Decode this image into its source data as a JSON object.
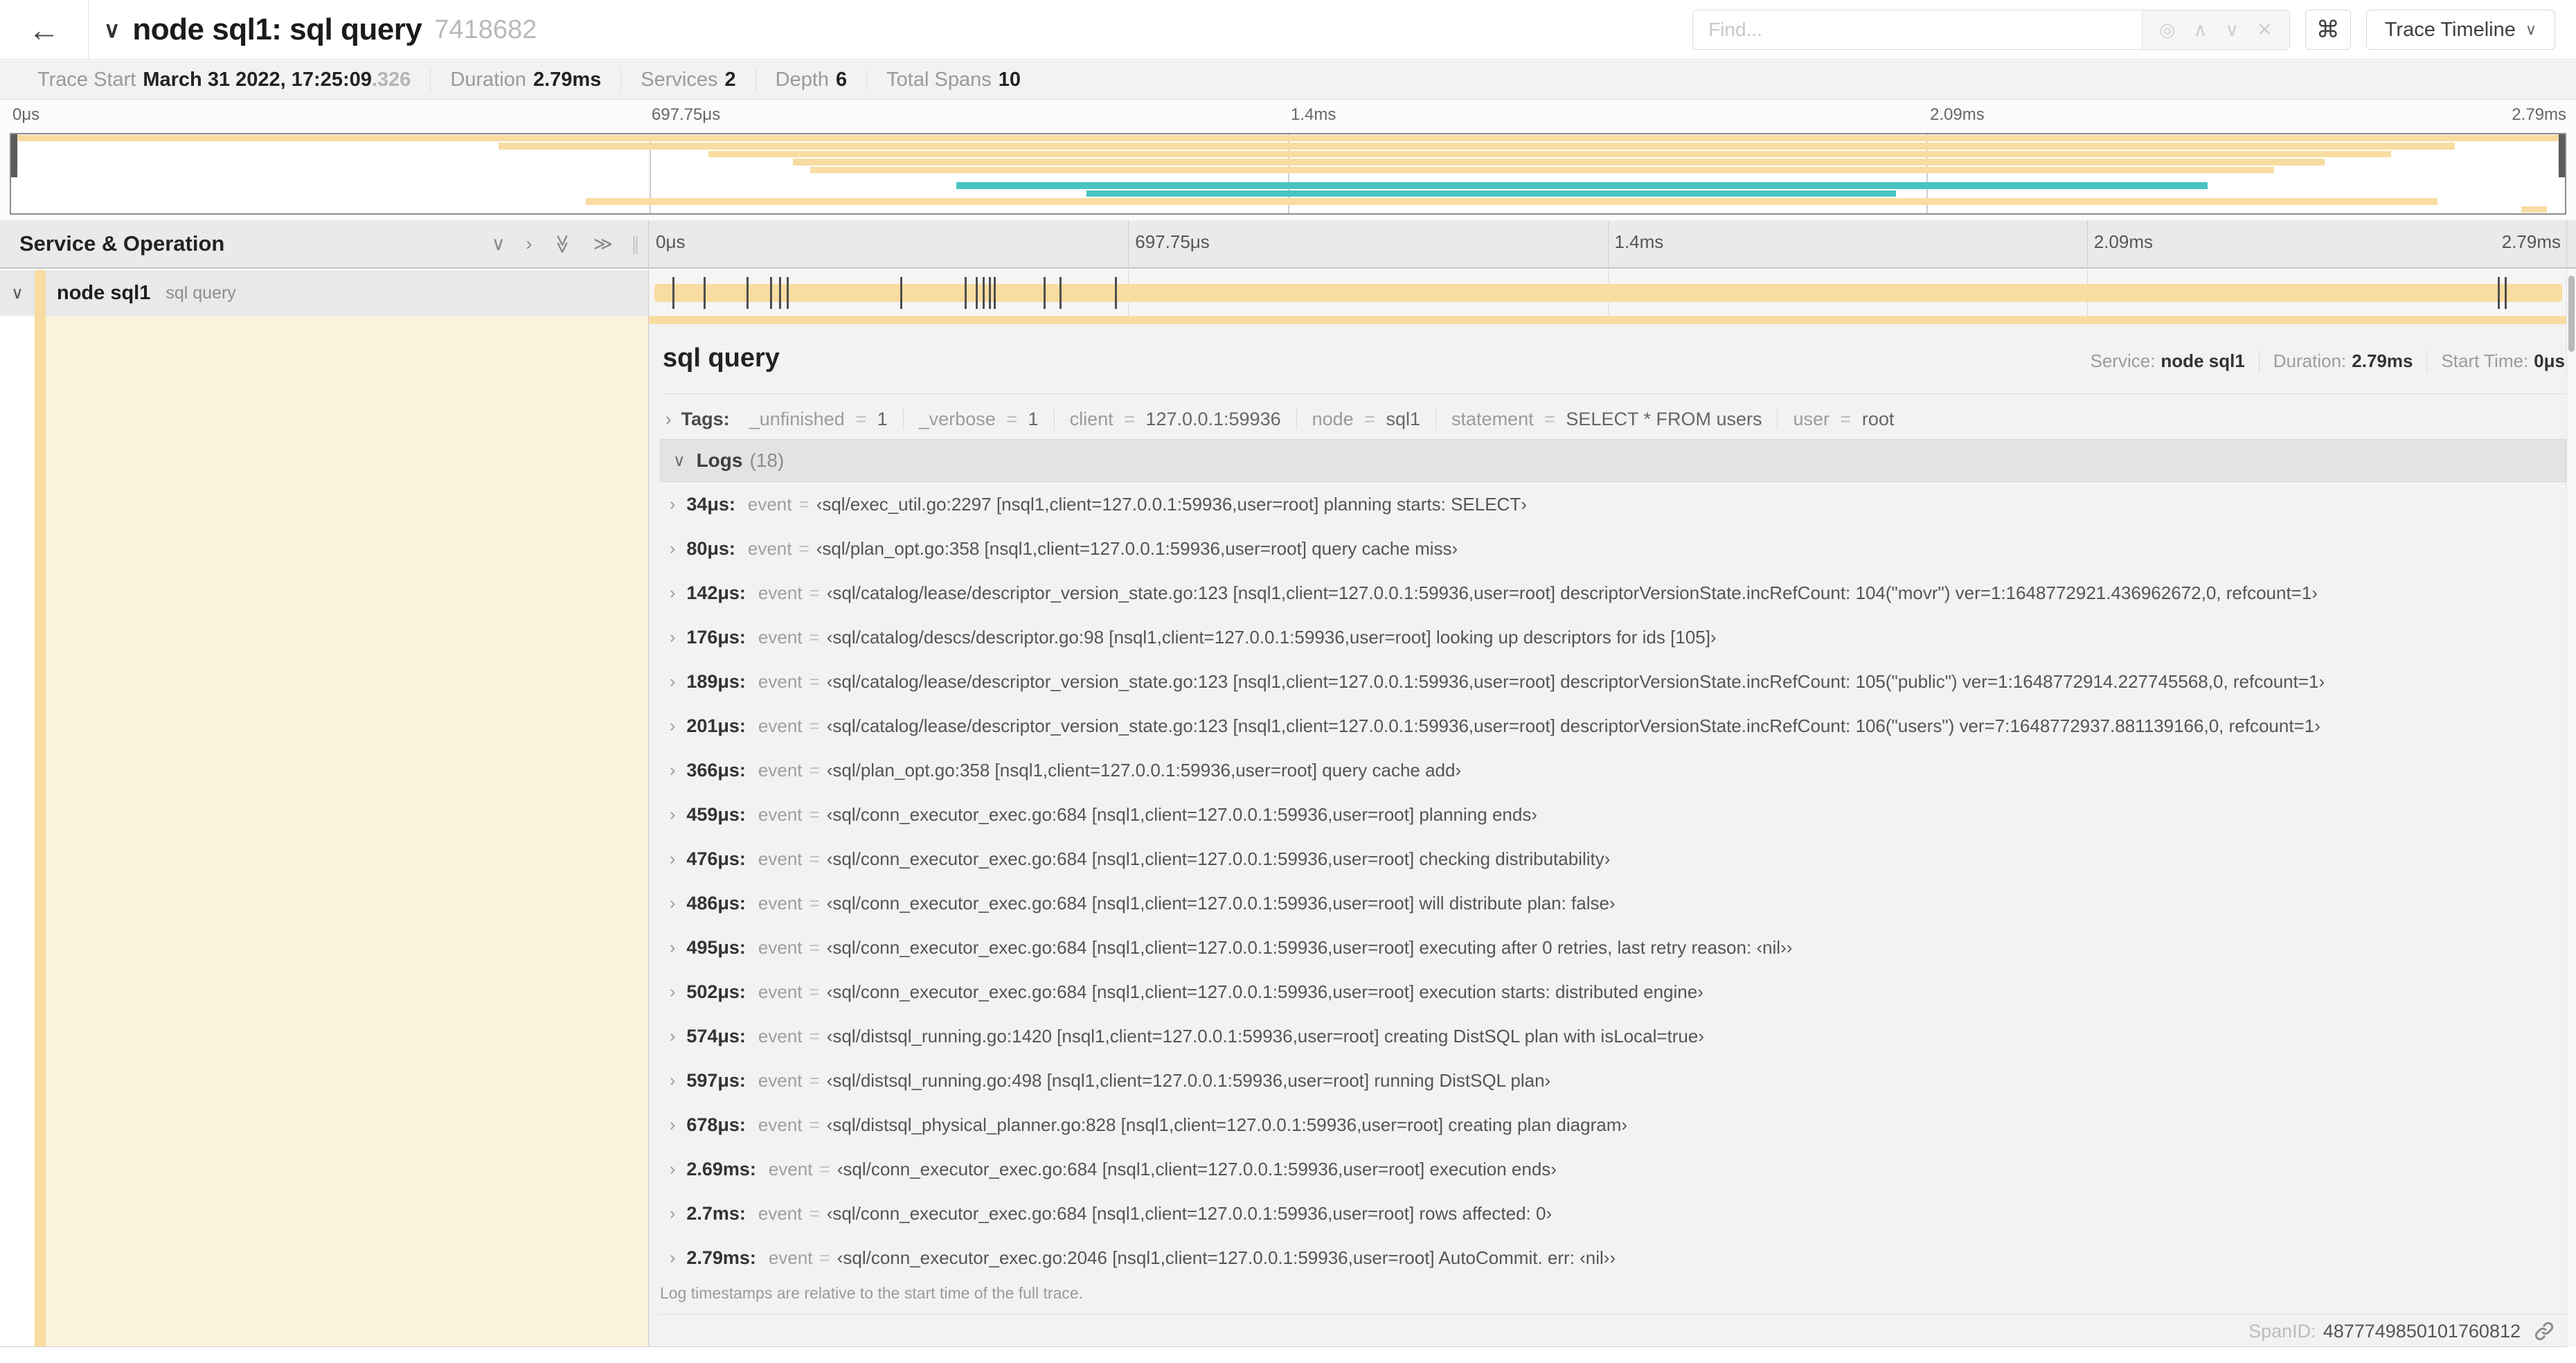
{
  "icons": {
    "back": "←",
    "chevron_down": "∨",
    "chevron_right": "›",
    "chevron_up": "∧",
    "double_chevron": "≫",
    "close": "✕",
    "locate": "◎",
    "command": "⌘",
    "grip": "∥"
  },
  "header": {
    "title": "node sql1: sql query",
    "trace_id_short": "7418682",
    "find_placeholder": "Find...",
    "view_selector_label": "Trace Timeline"
  },
  "summary": {
    "trace_start_label": "Trace Start",
    "trace_start_value": "March 31 2022, 17:25:09",
    "trace_start_fraction": ".326",
    "duration_label": "Duration",
    "duration_value": "2.79ms",
    "services_label": "Services",
    "services_value": "2",
    "depth_label": "Depth",
    "depth_value": "6",
    "spans_label": "Total Spans",
    "spans_value": "10"
  },
  "timeline": {
    "column_header": "Service & Operation",
    "ticks": [
      "0μs",
      "697.75μs",
      "1.4ms",
      "2.09ms",
      "2.79ms"
    ],
    "row": {
      "service": "node sql1",
      "operation": "sql query"
    }
  },
  "minimap": {
    "colors": {
      "wheat": "#F8DCA1",
      "teal": "#4AC4C2"
    },
    "spans": [
      {
        "start": 0,
        "end": 100,
        "color": "wheat"
      },
      {
        "start": 19.1,
        "end": 95.7,
        "color": "wheat"
      },
      {
        "start": 27.3,
        "end": 93.2,
        "color": "wheat"
      },
      {
        "start": 30.6,
        "end": 90.6,
        "color": "wheat"
      },
      {
        "start": 31.3,
        "end": 88.6,
        "color": "wheat"
      },
      {
        "start": 0,
        "end": 0,
        "color": null
      },
      {
        "start": 37.0,
        "end": 86.0,
        "color": "teal"
      },
      {
        "start": 42.1,
        "end": 73.8,
        "color": "teal"
      },
      {
        "start": 22.5,
        "end": 95.0,
        "color": "wheat"
      },
      {
        "start": 98.3,
        "end": 99.3,
        "color": "wheat"
      }
    ]
  },
  "detail": {
    "title": "sql query",
    "service_label": "Service:",
    "service_value": "node sql1",
    "duration_label": "Duration:",
    "duration_value": "2.79ms",
    "start_label": "Start Time:",
    "start_value": "0μs",
    "tags_label": "Tags:",
    "eq": "=",
    "tags": [
      {
        "key": "_unfinished",
        "value": "1"
      },
      {
        "key": "_verbose",
        "value": "1"
      },
      {
        "key": "client",
        "value": "127.0.0.1:59936"
      },
      {
        "key": "node",
        "value": "sql1"
      },
      {
        "key": "statement",
        "value": "SELECT * FROM users"
      },
      {
        "key": "user",
        "value": "root"
      }
    ],
    "logs_label": "Logs",
    "logs_count": "(18)",
    "log_field": "event",
    "logs": [
      {
        "time": "34μs:",
        "value": "‹sql/exec_util.go:2297 [nsql1,client=127.0.0.1:59936,user=root] planning starts: SELECT›"
      },
      {
        "time": "80μs:",
        "value": "‹sql/plan_opt.go:358 [nsql1,client=127.0.0.1:59936,user=root] query cache miss›"
      },
      {
        "time": "142μs:",
        "value": "‹sql/catalog/lease/descriptor_version_state.go:123 [nsql1,client=127.0.0.1:59936,user=root] descriptorVersionState.incRefCount: 104(\"movr\") ver=1:1648772921.436962672,0, refcount=1›"
      },
      {
        "time": "176μs:",
        "value": "‹sql/catalog/descs/descriptor.go:98 [nsql1,client=127.0.0.1:59936,user=root] looking up descriptors for ids [105]›"
      },
      {
        "time": "189μs:",
        "value": "‹sql/catalog/lease/descriptor_version_state.go:123 [nsql1,client=127.0.0.1:59936,user=root] descriptorVersionState.incRefCount: 105(\"public\") ver=1:1648772914.227745568,0, refcount=1›"
      },
      {
        "time": "201μs:",
        "value": "‹sql/catalog/lease/descriptor_version_state.go:123 [nsql1,client=127.0.0.1:59936,user=root] descriptorVersionState.incRefCount: 106(\"users\") ver=7:1648772937.881139166,0, refcount=1›"
      },
      {
        "time": "366μs:",
        "value": "‹sql/plan_opt.go:358 [nsql1,client=127.0.0.1:59936,user=root] query cache add›"
      },
      {
        "time": "459μs:",
        "value": "‹sql/conn_executor_exec.go:684 [nsql1,client=127.0.0.1:59936,user=root] planning ends›"
      },
      {
        "time": "476μs:",
        "value": "‹sql/conn_executor_exec.go:684 [nsql1,client=127.0.0.1:59936,user=root] checking distributability›"
      },
      {
        "time": "486μs:",
        "value": "‹sql/conn_executor_exec.go:684 [nsql1,client=127.0.0.1:59936,user=root] will distribute plan: false›"
      },
      {
        "time": "495μs:",
        "value": "‹sql/conn_executor_exec.go:684 [nsql1,client=127.0.0.1:59936,user=root] executing after 0 retries, last retry reason: ‹nil››"
      },
      {
        "time": "502μs:",
        "value": "‹sql/conn_executor_exec.go:684 [nsql1,client=127.0.0.1:59936,user=root] execution starts: distributed engine›"
      },
      {
        "time": "574μs:",
        "value": "‹sql/distsql_running.go:1420 [nsql1,client=127.0.0.1:59936,user=root] creating DistSQL plan with isLocal=true›"
      },
      {
        "time": "597μs:",
        "value": "‹sql/distsql_running.go:498 [nsql1,client=127.0.0.1:59936,user=root] running DistSQL plan›"
      },
      {
        "time": "678μs:",
        "value": "‹sql/distsql_physical_planner.go:828 [nsql1,client=127.0.0.1:59936,user=root] creating plan diagram›"
      },
      {
        "time": "2.69ms:",
        "value": "‹sql/conn_executor_exec.go:684 [nsql1,client=127.0.0.1:59936,user=root] execution ends›"
      },
      {
        "time": "2.7ms:",
        "value": "‹sql/conn_executor_exec.go:684 [nsql1,client=127.0.0.1:59936,user=root] rows affected: 0›"
      },
      {
        "time": "2.79ms:",
        "value": "‹sql/conn_executor_exec.go:2046 [nsql1,client=127.0.0.1:59936,user=root] AutoCommit. err: ‹nil››"
      }
    ],
    "footnote": "Log timestamps are relative to the start time of the full trace.",
    "span_id_label": "SpanID:",
    "span_id_value": "4877749850101760812"
  }
}
